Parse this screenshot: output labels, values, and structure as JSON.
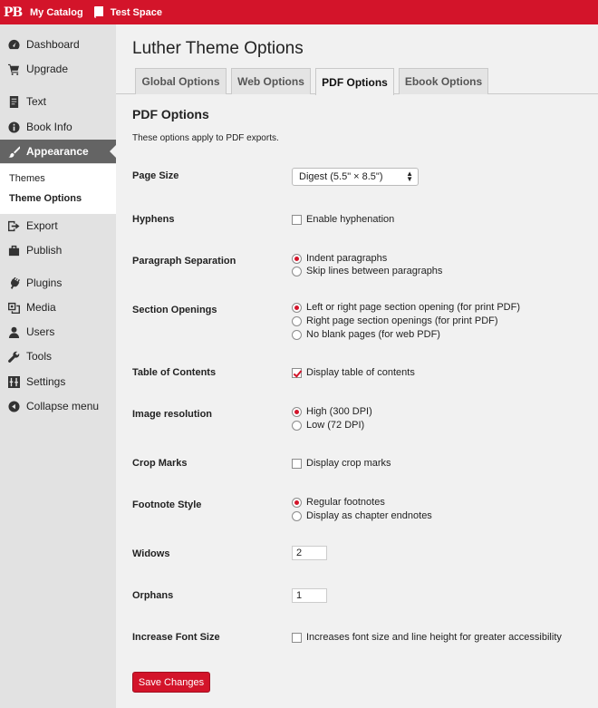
{
  "adminbar": {
    "logo": "PB",
    "my_catalog": "My Catalog",
    "book_title": "Test Space"
  },
  "sidebar": {
    "items": [
      {
        "label": "Dashboard",
        "icon": "dashboard-icon"
      },
      {
        "label": "Upgrade",
        "icon": "cart-icon"
      },
      {
        "label": "Text",
        "icon": "text-icon"
      },
      {
        "label": "Book Info",
        "icon": "info-icon"
      },
      {
        "label": "Appearance",
        "icon": "brush-icon"
      },
      {
        "label": "Export",
        "icon": "export-icon"
      },
      {
        "label": "Publish",
        "icon": "publish-icon"
      },
      {
        "label": "Plugins",
        "icon": "plugin-icon"
      },
      {
        "label": "Media",
        "icon": "media-icon"
      },
      {
        "label": "Users",
        "icon": "users-icon"
      },
      {
        "label": "Tools",
        "icon": "wrench-icon"
      },
      {
        "label": "Settings",
        "icon": "settings-icon"
      },
      {
        "label": "Collapse menu",
        "icon": "collapse-icon"
      }
    ],
    "submenu": [
      "Themes",
      "Theme Options"
    ]
  },
  "main": {
    "title": "Luther Theme Options",
    "tabs": [
      "Global Options",
      "Web Options",
      "PDF Options",
      "Ebook Options"
    ],
    "section_heading": "PDF Options",
    "section_desc": "These options apply to PDF exports.",
    "fields": {
      "page_size": {
        "label": "Page Size",
        "value": "Digest (5.5\" × 8.5\")"
      },
      "hyphens": {
        "label": "Hyphens",
        "option": "Enable hyphenation"
      },
      "paragraph_separation": {
        "label": "Paragraph Separation",
        "options": [
          "Indent paragraphs",
          "Skip lines between paragraphs"
        ]
      },
      "section_openings": {
        "label": "Section Openings",
        "options": [
          "Left or right page section opening (for print PDF)",
          "Right page section openings (for print PDF)",
          "No blank pages (for web PDF)"
        ]
      },
      "toc": {
        "label": "Table of Contents",
        "option": "Display table of contents"
      },
      "image_resolution": {
        "label": "Image resolution",
        "options": [
          "High (300 DPI)",
          "Low (72 DPI)"
        ]
      },
      "crop_marks": {
        "label": "Crop Marks",
        "option": "Display crop marks"
      },
      "footnote_style": {
        "label": "Footnote Style",
        "options": [
          "Regular footnotes",
          "Display as chapter endnotes"
        ]
      },
      "widows": {
        "label": "Widows",
        "value": "2"
      },
      "orphans": {
        "label": "Orphans",
        "value": "1"
      },
      "font_size": {
        "label": "Increase Font Size",
        "option": "Increases font size and line height for greater accessibility"
      }
    },
    "save_label": "Save Changes"
  },
  "colors": {
    "accent": "#d3142a",
    "sidebar_bg": "#e2e2e2",
    "sidebar_active": "#646464",
    "page_bg": "#f1f1f1"
  }
}
